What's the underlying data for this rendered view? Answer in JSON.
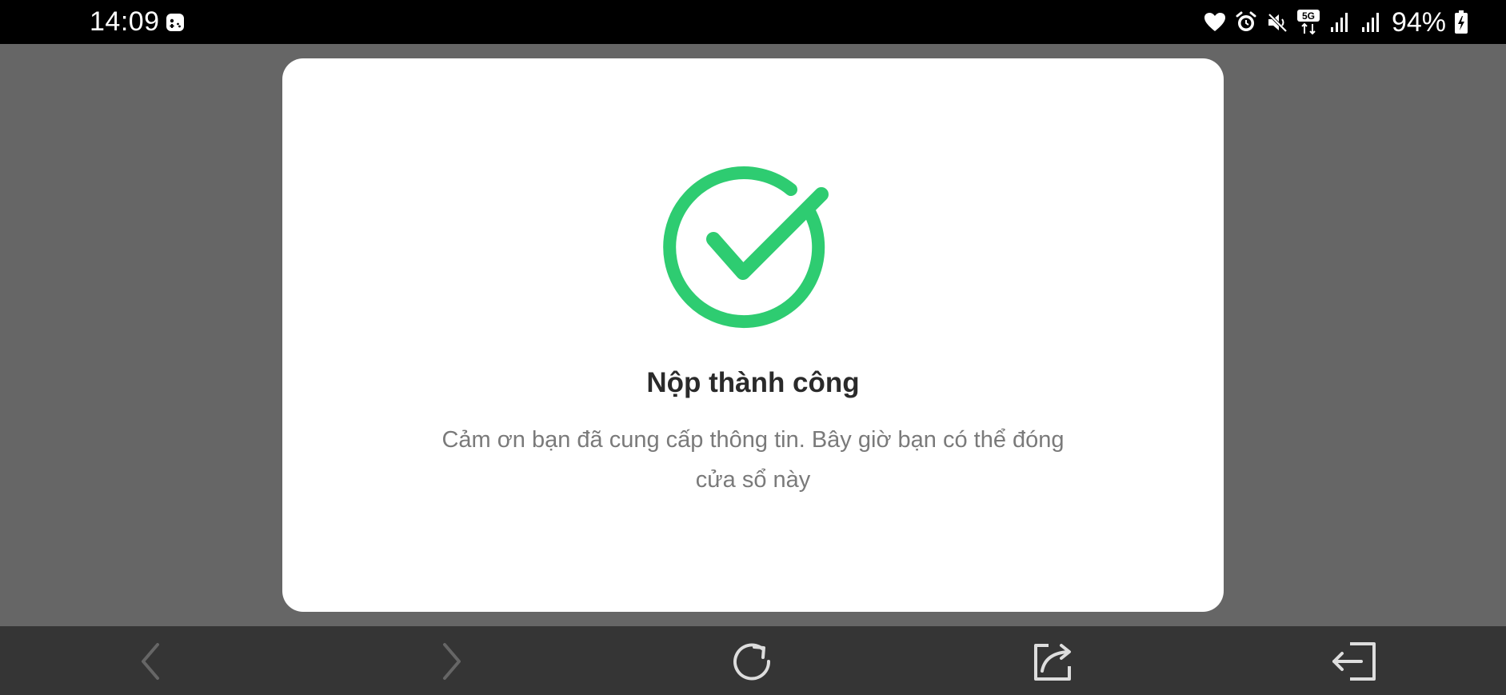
{
  "status_bar": {
    "time": "14:09",
    "battery_percent": "94%",
    "network_badge": "5G",
    "icons": [
      "game-controller-icon",
      "heart-icon",
      "alarm-icon",
      "mute-icon",
      "5g-icon",
      "signal-icon",
      "signal-icon",
      "battery-charging-icon"
    ]
  },
  "modal": {
    "title": "Nộp thành công",
    "message_line1": "Cảm ơn bạn đã cung cấp thông tin. Bây giờ bạn có thể đóng",
    "message_line2": "cửa sổ này",
    "icon": "check-circle-icon",
    "accent_color": "#2ecc71"
  },
  "bottom_nav": {
    "items": [
      "back-icon",
      "forward-icon",
      "reload-icon",
      "share-icon",
      "exit-icon"
    ]
  },
  "colors": {
    "overlay": "#666666",
    "status_bar": "#000000",
    "bottom_bar": "#353535",
    "modal_bg": "#ffffff",
    "success_green": "#2ecc71"
  }
}
